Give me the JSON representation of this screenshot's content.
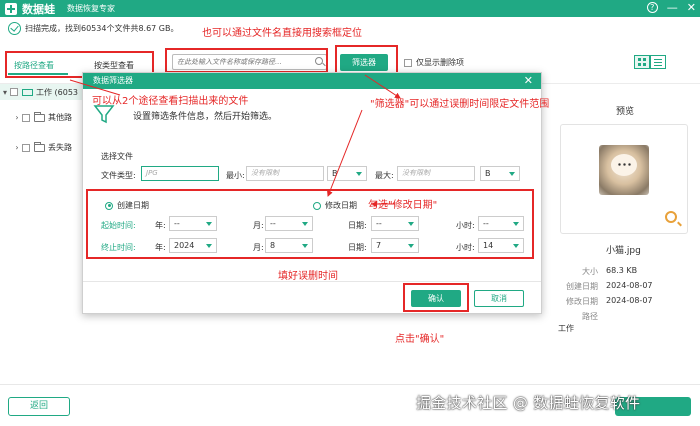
{
  "app": {
    "logo_text": "数据蛙",
    "subtitle": "数据恢复专家",
    "window_controls": [
      "?",
      "—",
      "✕"
    ]
  },
  "status": {
    "text": "扫描完成，找到60534个文件共8.67 GB。"
  },
  "toolbar": {
    "tab_path": "按路径查看",
    "tab_type": "按类型查看",
    "search_placeholder": "在此处输入文件名称或保存路径...",
    "filter_button": "筛选器",
    "only_deleted": "仅显示删除项"
  },
  "tree": {
    "items": [
      {
        "label": "工作 (6053",
        "expanded": true,
        "selected": true
      },
      {
        "label": "其他路",
        "expanded": false
      },
      {
        "label": "丢失路",
        "expanded": false
      }
    ]
  },
  "preview": {
    "title": "预览",
    "file_name": "小猫.jpg",
    "meta": [
      {
        "key": "大小",
        "value": "68.3 KB"
      },
      {
        "key": "创建日期",
        "value": "2024-08-07"
      },
      {
        "key": "修改日期",
        "value": "2024-08-07"
      },
      {
        "key": "路径",
        "value": ""
      }
    ],
    "path_value": "工作"
  },
  "modal": {
    "title": "数据筛选器",
    "subtitle": "设置筛选条件信息，然后开始筛选。",
    "section_label": "选择文件",
    "file_type_label": "文件类型:",
    "file_type_placeholder": "JPG",
    "min_label": "最小:",
    "min_placeholder": "没有限制",
    "min_unit": "B",
    "max_label": "最大:",
    "max_placeholder": "没有限制",
    "max_unit": "B",
    "radio_created": "创建日期",
    "radio_modified": "修改日期",
    "start_label": "起始时间:",
    "end_label": "终止时间:",
    "year_label": "年:",
    "month_label": "月:",
    "day_label": "日期:",
    "hour_label": "小时:",
    "start": {
      "year": "--",
      "month": "--",
      "day": "--",
      "hour": "--"
    },
    "end": {
      "year": "2024",
      "month": "8",
      "day": "7",
      "hour": "14"
    },
    "ok": "确认",
    "cancel": "取消"
  },
  "footer": {
    "back": "返回",
    "watermark": "掘金技术社区 @ 数据蛙恢复软件"
  },
  "annotations": {
    "a_search": "也可以通过文件名直接用搜索框定位",
    "a_two_ways": "可以从2个途径查看扫描出来的文件",
    "a_filter": "\"筛选器\"可以通过误删时间限定文件范围",
    "a_modified": "勾选\"修改日期\"",
    "a_fill_time": "填好误删时间",
    "a_click_ok": "点击\"确认\""
  },
  "colors": {
    "brand": "#20a984",
    "annotation": "#e52727"
  }
}
